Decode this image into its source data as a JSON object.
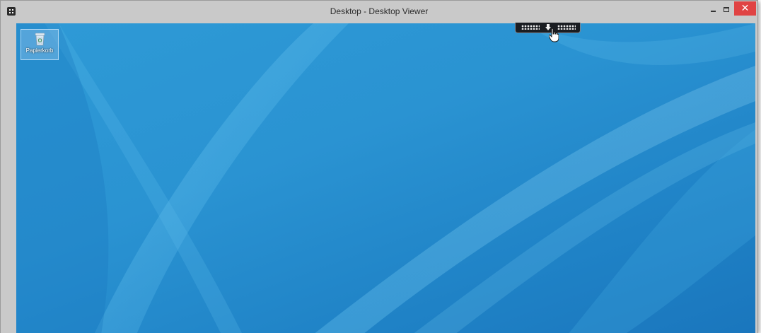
{
  "window": {
    "title": "Desktop - Desktop Viewer",
    "controls": {
      "minimize": "–",
      "maximize": "□",
      "close": "✕"
    },
    "close_color": "#e04343"
  },
  "desktop": {
    "background_color": "#2a93d2",
    "icons": [
      {
        "label": "Papierkorb",
        "icon": "recycle-bin-icon"
      }
    ]
  },
  "connection_bar": {
    "left_grip_icon": "grip-icon",
    "center_icon": "pin-icon",
    "right_grip_icon": "grip-icon"
  },
  "pointer": {
    "icon": "hand-cursor-icon"
  }
}
